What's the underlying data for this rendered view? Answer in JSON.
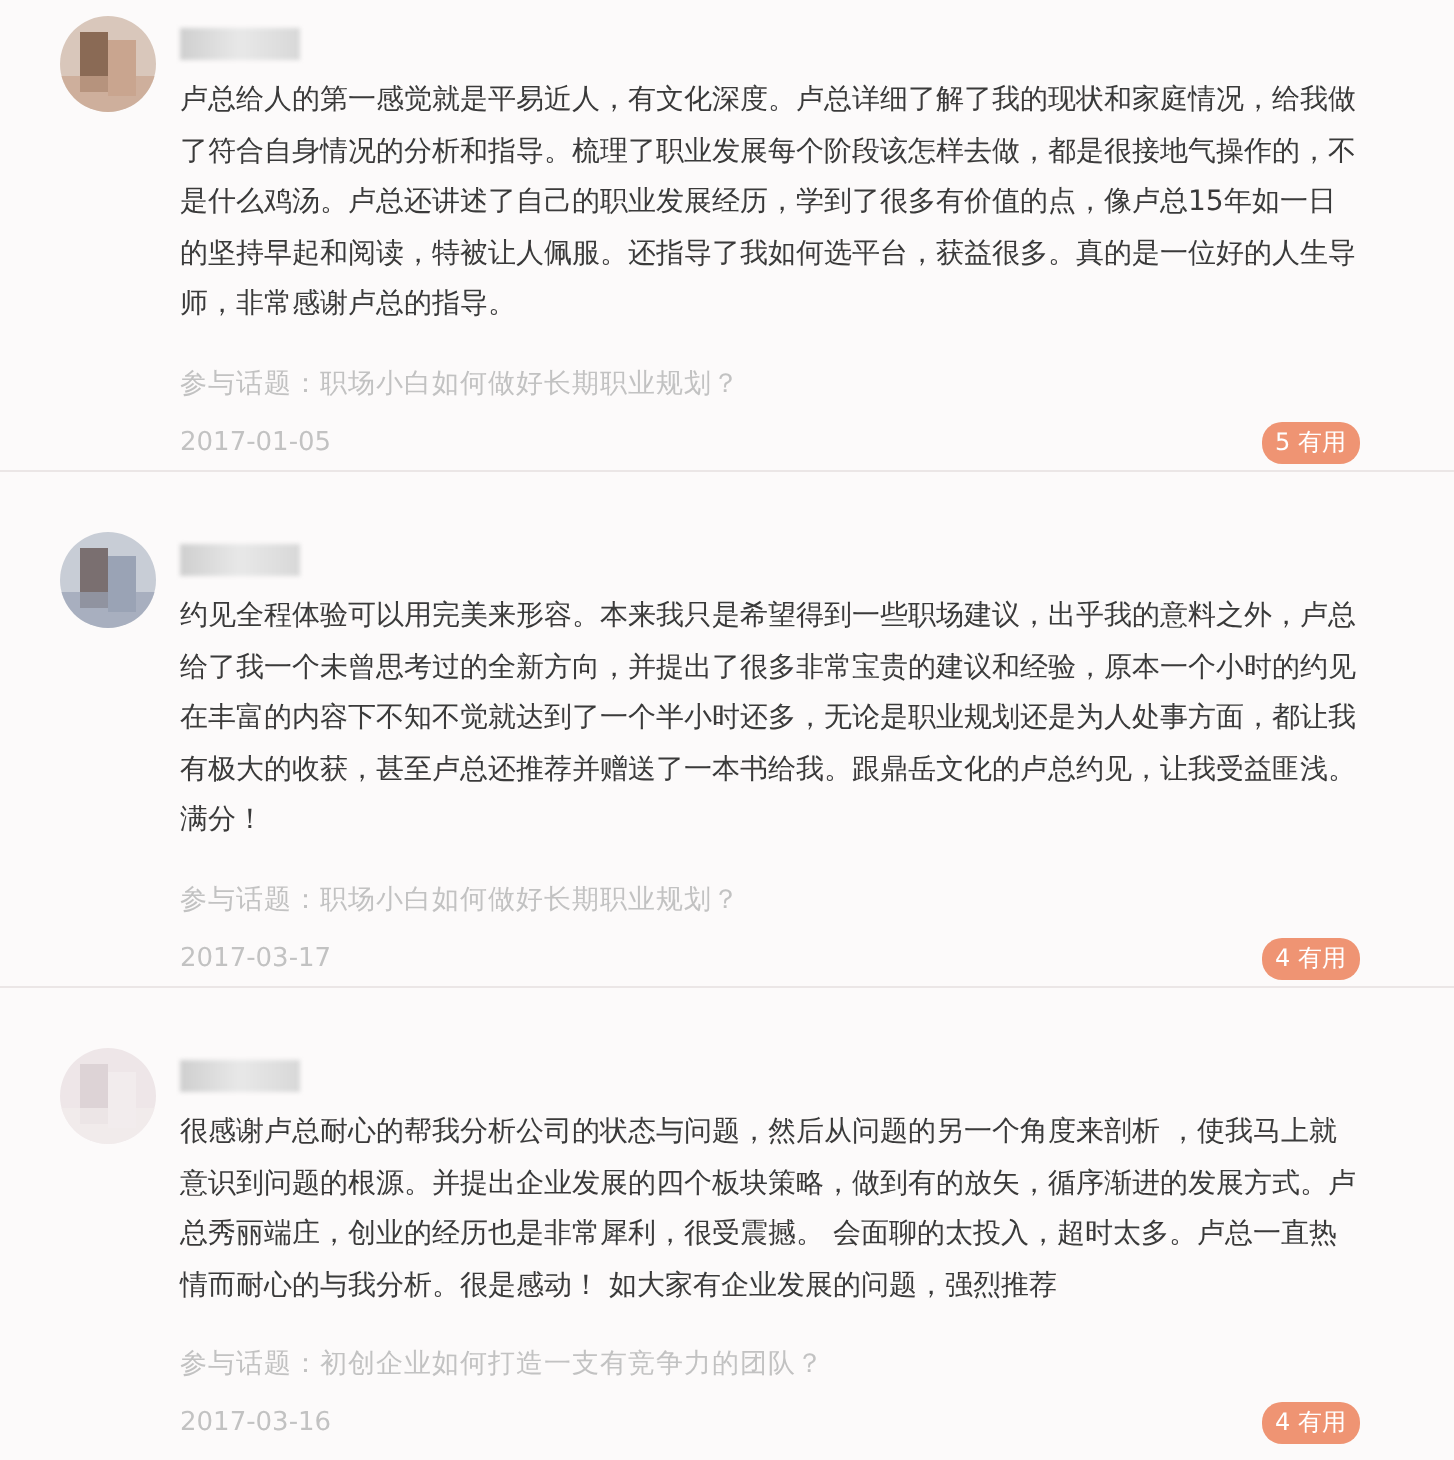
{
  "reviews": [
    {
      "text": "卢总给人的第一感觉就是平易近人，有文化深度。卢总详细了解了我的现状和家庭情况，给我做了符合自身情况的分析和指导。梳理了职业发展每个阶段该怎样去做，都是很接地气操作的，不是什么鸡汤。卢总还讲述了自己的职业发展经历，学到了很多有价值的点，像卢总15年如一日的坚持早起和阅读，特被让人佩服。还指导了我如何选平台，获益很多。真的是一位好的人生导师，非常感谢卢总的指导。",
      "topic": "参与话题：职场小白如何做好长期职业规划？",
      "date": "2017-01-05",
      "useful": "5 有用"
    },
    {
      "text": "约见全程体验可以用完美来形容。本来我只是希望得到一些职场建议，出乎我的意料之外，卢总给了我一个未曾思考过的全新方向，并提出了很多非常宝贵的建议和经验，原本一个小时的约见在丰富的内容下不知不觉就达到了一个半小时还多，无论是职业规划还是为人处事方面，都让我有极大的收获，甚至卢总还推荐并赠送了一本书给我。跟鼎岳文化的卢总约见，让我受益匪浅。满分！",
      "topic": "参与话题：职场小白如何做好长期职业规划？",
      "date": "2017-03-17",
      "useful": "4 有用"
    },
    {
      "text": "很感谢卢总耐心的帮我分析公司的状态与问题，然后从问题的另一个角度来剖析 ，使我马上就意识到问题的根源。并提出企业发展的四个板块策略，做到有的放矢，循序渐进的发展方式。卢总秀丽端庄，创业的经历也是非常犀利，很受震撼。 会面聊的太投入，超时太多。卢总一直热情而耐心的与我分析。很是感动！ 如大家有企业发展的问题，强烈推荐",
      "topic": "参与话题：初创企业如何打造一支有竞争力的团队？",
      "date": "2017-03-16",
      "useful": "4 有用"
    }
  ]
}
